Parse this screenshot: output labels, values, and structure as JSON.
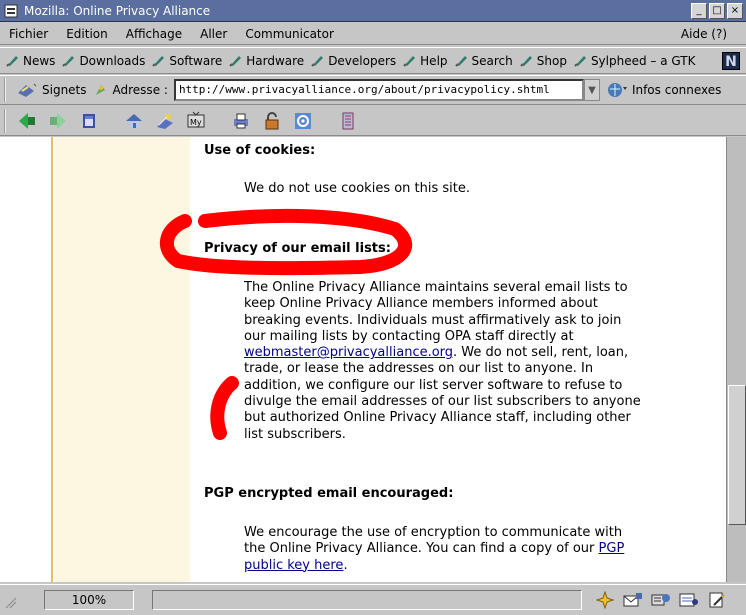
{
  "window": {
    "title": "Mozilla: Online Privacy Alliance"
  },
  "menu": {
    "items": [
      "Fichier",
      "Edition",
      "Affichage",
      "Aller",
      "Communicator"
    ],
    "help": "Aide (?)"
  },
  "personal_toolbar": {
    "items": [
      "News",
      "Downloads",
      "Software",
      "Hardware",
      "Developers",
      "Help",
      "Search",
      "Shop",
      "Sylpheed – a GTK"
    ],
    "logo": "N"
  },
  "navigation": {
    "bookmarks_label": "Signets",
    "address_label": "Adresse :",
    "url": "http://www.privacyalliance.org/about/privacypolicy.shtml",
    "related_label": "Infos connexes"
  },
  "page": {
    "section1": {
      "heading": "Use of cookies:",
      "text": "We do not use cookies on this site."
    },
    "section2": {
      "heading": "Privacy of our email lists:",
      "text_before": "The Online Privacy Alliance maintains several email lists to keep Online Privacy Alliance members informed about breaking events. Individuals must affirmatively ask to join our mailing lists by contacting OPA staff directly at ",
      "email_link": "webmaster@privacyalliance.org",
      "text_after": ". We do not sell, rent, loan, trade, or lease the addresses on our list to anyone. In addition, we configure our list server software to refuse to divulge the email addresses of our list subscribers to anyone but authorized Online Privacy Alliance staff, including other list subscribers."
    },
    "section3": {
      "heading": "PGP encrypted email encouraged:",
      "text_before": "We encourage the use of encryption to communicate with the Online Privacy Alliance. You can find a copy of our ",
      "link": "PGP public key here",
      "text_after": "."
    }
  },
  "annotations": {
    "color": "#ff0000"
  },
  "status": {
    "zoom": "100%"
  }
}
